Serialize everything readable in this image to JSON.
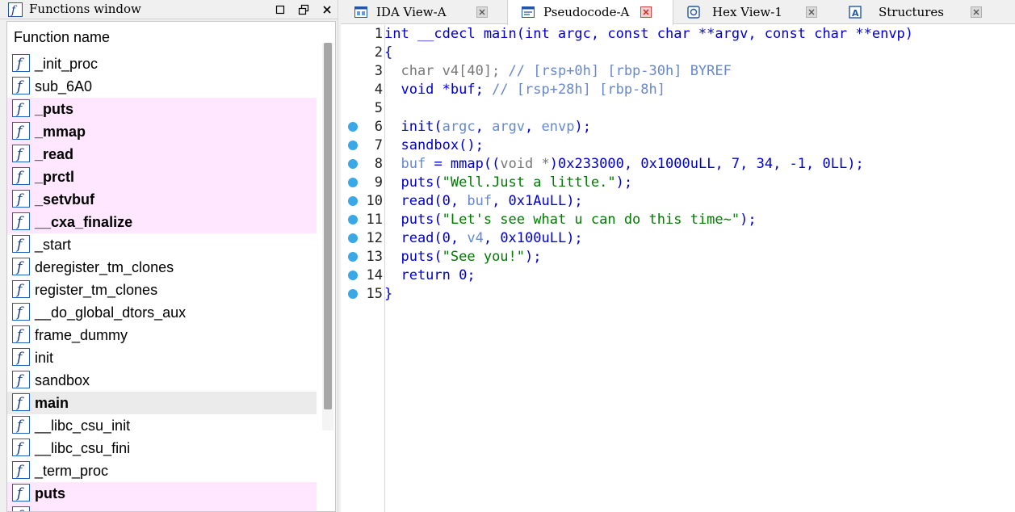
{
  "functions_window": {
    "title": "Functions window",
    "header": "Function name",
    "items": [
      {
        "name": "_init_proc",
        "kind": "normal"
      },
      {
        "name": "sub_6A0",
        "kind": "normal"
      },
      {
        "name": "_puts",
        "kind": "lib"
      },
      {
        "name": "_mmap",
        "kind": "lib"
      },
      {
        "name": "_read",
        "kind": "lib"
      },
      {
        "name": "_prctl",
        "kind": "lib"
      },
      {
        "name": "_setvbuf",
        "kind": "lib"
      },
      {
        "name": "__cxa_finalize",
        "kind": "lib"
      },
      {
        "name": "_start",
        "kind": "normal"
      },
      {
        "name": "deregister_tm_clones",
        "kind": "normal"
      },
      {
        "name": "register_tm_clones",
        "kind": "normal"
      },
      {
        "name": "__do_global_dtors_aux",
        "kind": "normal"
      },
      {
        "name": "frame_dummy",
        "kind": "normal"
      },
      {
        "name": "init",
        "kind": "normal"
      },
      {
        "name": "sandbox",
        "kind": "normal"
      },
      {
        "name": "main",
        "kind": "selected"
      },
      {
        "name": "__libc_csu_init",
        "kind": "normal"
      },
      {
        "name": "__libc_csu_fini",
        "kind": "normal"
      },
      {
        "name": "_term_proc",
        "kind": "normal"
      },
      {
        "name": "puts",
        "kind": "lib"
      },
      {
        "name": "",
        "kind": "lib"
      }
    ]
  },
  "tabs": [
    {
      "label": "IDA View-A",
      "icon": "ida-view-icon",
      "active": false
    },
    {
      "label": "Pseudocode-A",
      "icon": "pseudocode-icon",
      "active": true
    },
    {
      "label": "Hex View-1",
      "icon": "hex-view-icon",
      "active": false
    },
    {
      "label": "Structures",
      "icon": "structures-icon",
      "active": false
    }
  ],
  "code_lines": [
    {
      "n": "1",
      "bp": false,
      "segs": [
        [
          "kw",
          "int __cdecl main(int argc, const char **argv, const char **envp)"
        ]
      ]
    },
    {
      "n": "2",
      "bp": false,
      "segs": [
        [
          "kw",
          "{"
        ]
      ]
    },
    {
      "n": "3",
      "bp": false,
      "segs": [
        [
          "tx-gray",
          "  char v4[40]; "
        ],
        [
          "cmt",
          "// [rsp+0h] [rbp-30h] BYREF"
        ]
      ]
    },
    {
      "n": "4",
      "bp": false,
      "segs": [
        [
          "kw",
          "  void *buf; "
        ],
        [
          "cmt",
          "// [rsp+28h] [rbp-8h]"
        ]
      ]
    },
    {
      "n": "5",
      "bp": false,
      "segs": [
        [
          "kw",
          ""
        ]
      ]
    },
    {
      "n": "6",
      "bp": true,
      "segs": [
        [
          "kw",
          "  init("
        ],
        [
          "cmt",
          "argc"
        ],
        [
          "kw",
          ", "
        ],
        [
          "cmt",
          "argv"
        ],
        [
          "kw",
          ", "
        ],
        [
          "cmt",
          "envp"
        ],
        [
          "kw",
          ");"
        ]
      ]
    },
    {
      "n": "7",
      "bp": true,
      "segs": [
        [
          "kw",
          "  sandbox();"
        ]
      ]
    },
    {
      "n": "8",
      "bp": true,
      "segs": [
        [
          "kw",
          "  "
        ],
        [
          "cmt",
          "buf"
        ],
        [
          "kw",
          " = mmap(("
        ],
        [
          "tx-gray",
          "void *"
        ],
        [
          "kw",
          ")0x233000, 0x1000uLL, 7, 34, -1, 0LL);"
        ]
      ]
    },
    {
      "n": "9",
      "bp": true,
      "segs": [
        [
          "kw",
          "  puts("
        ],
        [
          "str",
          "\"Well.Just a little.\""
        ],
        [
          "kw",
          ");"
        ]
      ]
    },
    {
      "n": "10",
      "bp": true,
      "segs": [
        [
          "kw",
          "  read(0, "
        ],
        [
          "cmt",
          "buf"
        ],
        [
          "kw",
          ", 0x1AuLL);"
        ]
      ]
    },
    {
      "n": "11",
      "bp": true,
      "segs": [
        [
          "kw",
          "  puts("
        ],
        [
          "str",
          "\"Let's see what u can do this time~\""
        ],
        [
          "kw",
          ");"
        ]
      ]
    },
    {
      "n": "12",
      "bp": true,
      "segs": [
        [
          "kw",
          "  read(0, "
        ],
        [
          "cmt",
          "v4"
        ],
        [
          "kw",
          ", 0x100uLL);"
        ]
      ]
    },
    {
      "n": "13",
      "bp": true,
      "segs": [
        [
          "kw",
          "  puts("
        ],
        [
          "str",
          "\"See you!\""
        ],
        [
          "kw",
          ");"
        ]
      ]
    },
    {
      "n": "14",
      "bp": true,
      "segs": [
        [
          "kw",
          "  return 0;"
        ]
      ]
    },
    {
      "n": "15",
      "bp": true,
      "segs": [
        [
          "kw",
          "}"
        ]
      ]
    }
  ],
  "colors": {
    "keyword": "#0000cc",
    "string": "#007a00",
    "comment": "#6688cc",
    "lib_highlight": "#ffe8ff",
    "breakpoint": "#3aa8e6"
  }
}
